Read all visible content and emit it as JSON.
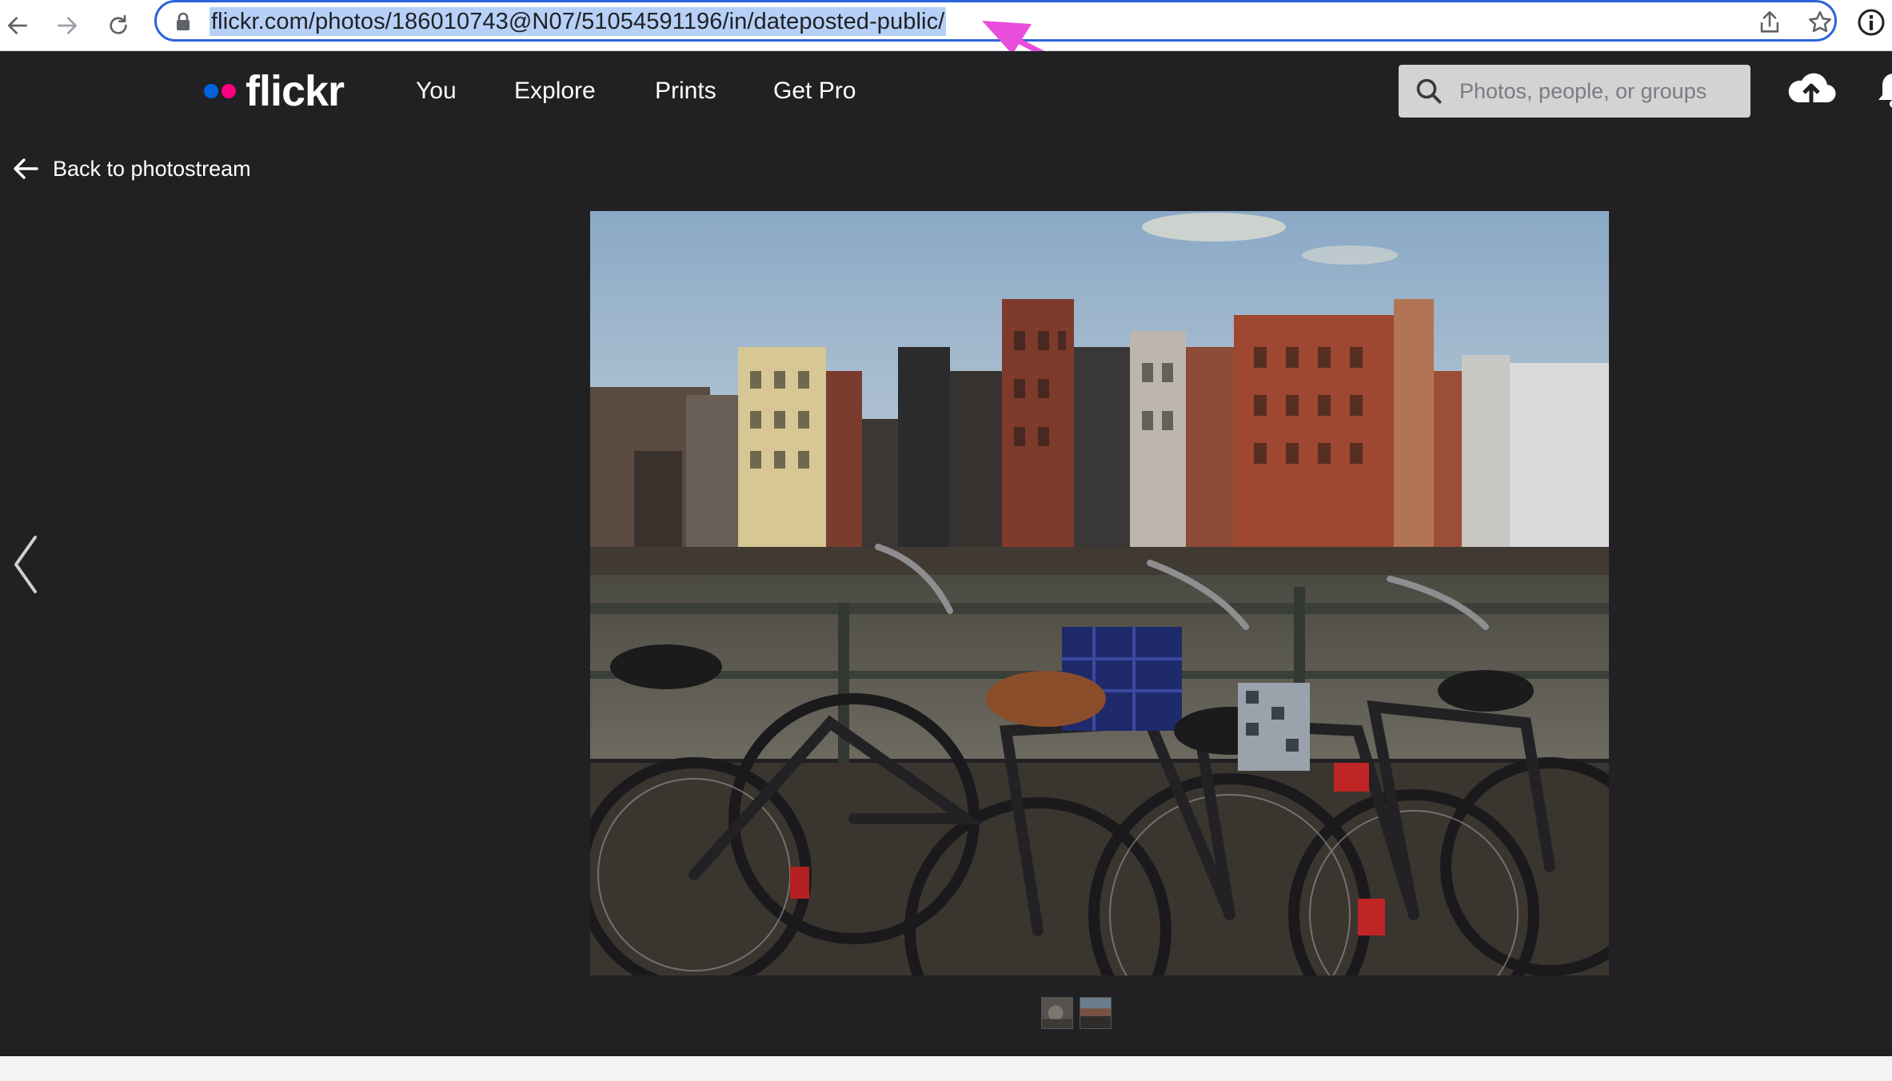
{
  "browser": {
    "url": "flickr.com/photos/186010743@N07/51054591196/in/dateposted-public/",
    "icons": [
      "back-arrow-icon",
      "forward-arrow-icon",
      "reload-icon",
      "lock-icon",
      "share-icon",
      "star-icon",
      "info-icon"
    ]
  },
  "header": {
    "logo_text": "flickr",
    "nav": [
      "You",
      "Explore",
      "Prints",
      "Get Pro"
    ],
    "search_placeholder": "Photos, people, or groups",
    "icons": [
      "search-icon",
      "upload-cloud-icon",
      "bell-icon"
    ]
  },
  "photo_page": {
    "back_label": "Back to photostream",
    "photo_subject": "bicycles-by-canal-houses",
    "thumbnail_count": 2
  },
  "colors": {
    "flickr_blue": "#0063dc",
    "flickr_pink": "#ff0084",
    "header_bg": "#212124",
    "url_highlight": "#b6d0f7",
    "annotation_arrow": "#e84ddc"
  }
}
